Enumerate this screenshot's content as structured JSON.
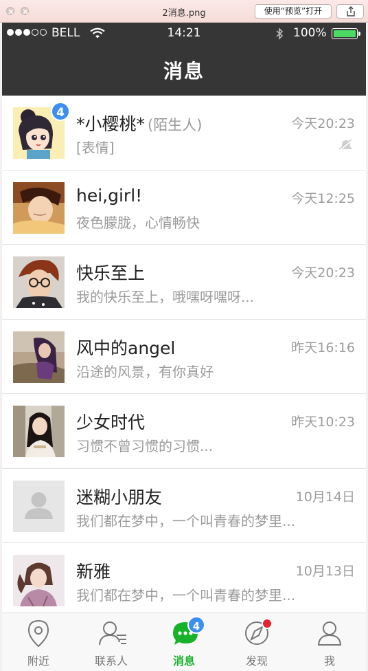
{
  "window": {
    "file_name": "2消息.png",
    "open_button_label": "使用“预览”打开"
  },
  "status_bar": {
    "carrier": "BELL",
    "time": "14:21",
    "battery": "100%",
    "signal_bars_filled": 3,
    "signal_bars_total": 5,
    "battery_level": 1.0
  },
  "nav": {
    "title": "消息"
  },
  "conversations": [
    {
      "name": "*小樱桃*",
      "tag": "(陌生人)",
      "time": "今天20:23",
      "preview": "[表情]",
      "badge": "4",
      "muted": true,
      "avatar": "cartoon-girl"
    },
    {
      "name": "hei,girl!",
      "tag": "",
      "time": "今天12:25",
      "preview": "夜色朦胧，心情畅快",
      "badge": "",
      "muted": false,
      "avatar": "boy-photo"
    },
    {
      "name": "快乐至上",
      "tag": "",
      "time": "今天20:23",
      "preview": "我的快乐至上，哦嘿呀嘿呀...",
      "badge": "",
      "muted": false,
      "avatar": "glasses-boy"
    },
    {
      "name": "风中的angel",
      "tag": "",
      "time": "昨天16:16",
      "preview": "沿途的风景，有你真好",
      "badge": "",
      "muted": false,
      "avatar": "field-girl"
    },
    {
      "name": "少女时代",
      "tag": "",
      "time": "昨天10:23",
      "preview": "习惯不曾习惯的习惯...",
      "badge": "",
      "muted": false,
      "avatar": "train-girl"
    },
    {
      "name": "迷糊小朋友",
      "tag": "",
      "time": "10月14日",
      "preview": "我们都在梦中，一个叫青春的梦里...",
      "badge": "",
      "muted": false,
      "avatar": "default"
    },
    {
      "name": "新雅",
      "tag": "",
      "time": "10月13日",
      "preview": "我们都在梦中，一个叫青春的梦里...",
      "badge": "",
      "muted": false,
      "avatar": "pigtail-girl"
    }
  ],
  "tabs": [
    {
      "label": "附近",
      "icon": "location-pin-icon",
      "active": false
    },
    {
      "label": "联系人",
      "icon": "contacts-icon",
      "active": false
    },
    {
      "label": "消息",
      "icon": "chat-bubble-icon",
      "active": true,
      "badge": "4"
    },
    {
      "label": "发现",
      "icon": "compass-icon",
      "active": false,
      "dot": true
    },
    {
      "label": "我",
      "icon": "profile-icon",
      "active": false
    }
  ],
  "colors": {
    "header": "#363636",
    "accent_green": "#18b22a",
    "badge_blue": "#3d8ef2",
    "dot_red": "#e8222f"
  }
}
